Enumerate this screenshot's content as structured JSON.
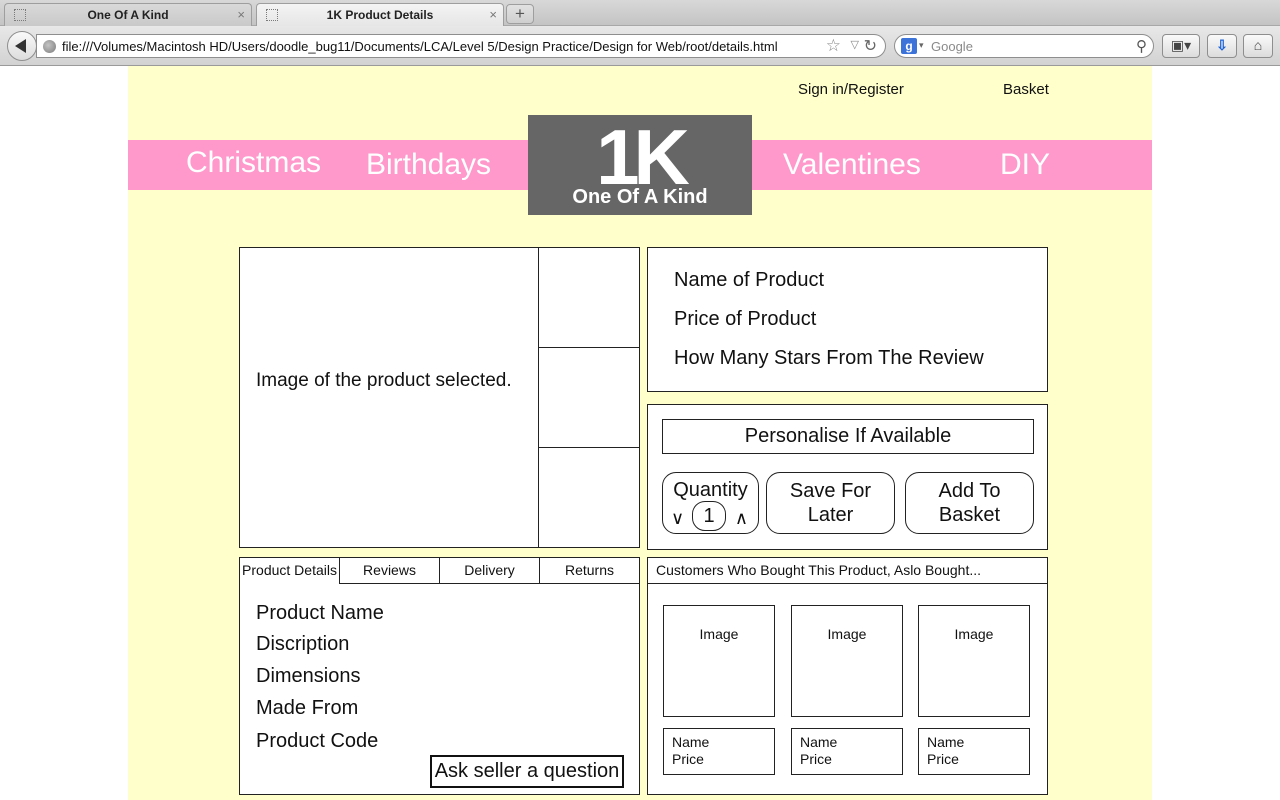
{
  "browser": {
    "tabs": [
      {
        "title": "One Of A Kind",
        "active": false
      },
      {
        "title": "1K Product Details",
        "active": true
      }
    ],
    "new_tab_icon": "+",
    "url": "file:///Volumes/Macintosh HD/Users/doodle_bug11/Documents/LCA/Level 5/Design Practice/Design for Web/root/details.html",
    "search_placeholder": "Google"
  },
  "header": {
    "signin_label": "Sign in/Register",
    "basket_label": "Basket",
    "categories": [
      "Christmas",
      "Birthdays",
      "Valentines",
      "DIY"
    ],
    "logo_mark": "1K",
    "logo_text": "One Of A Kind",
    "band_color": "#ff99cc",
    "page_color": "#ffffcc",
    "logo_color": "#666666"
  },
  "product": {
    "main_image_label": "Image of the product selected.",
    "summary": [
      "Name of Product",
      "Price of Product",
      "How Many Stars From The Review"
    ],
    "personalise_label": "Personalise If Available",
    "quantity_label": "Quantity",
    "quantity_value": "1",
    "save_label": "Save For Later",
    "add_basket_label": "Add To Basket"
  },
  "details": {
    "tabs": [
      "Product Details",
      "Reviews",
      "Delivery",
      "Returns"
    ],
    "lines": [
      "Product Name",
      "Discription",
      "Dimensions",
      "Made From",
      "Product Code"
    ],
    "ask_label": "Ask seller a question"
  },
  "related": {
    "header": "Customers Who Bought This Product, Aslo Bought...",
    "items": [
      {
        "image": "Image",
        "name": "Name",
        "price": "Price"
      },
      {
        "image": "Image",
        "name": "Name",
        "price": "Price"
      },
      {
        "image": "Image",
        "name": "Name",
        "price": "Price"
      }
    ]
  }
}
